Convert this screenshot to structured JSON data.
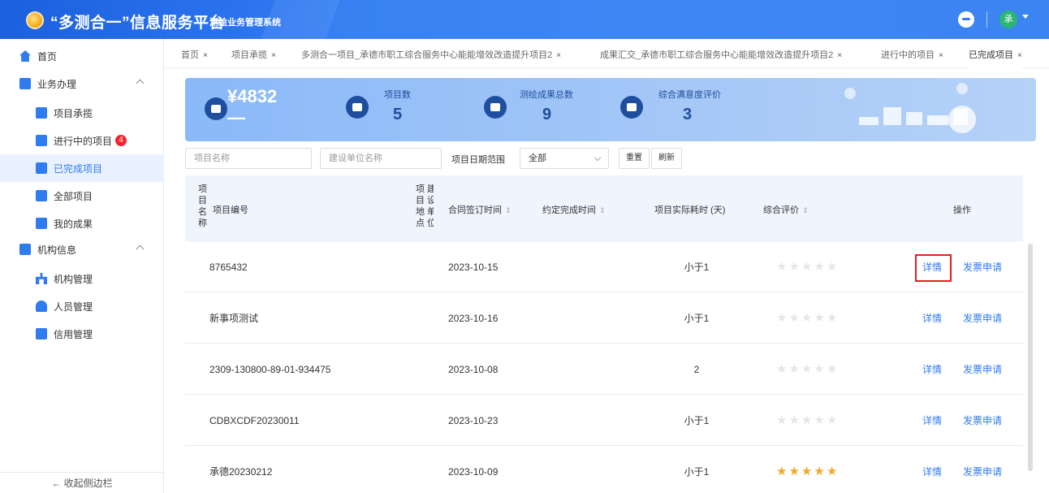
{
  "header": {
    "title": "“多测合一”信息服务平台",
    "subtitle": "测绘业务管理系统",
    "avatar_text": "承"
  },
  "sidebar": {
    "home": "首页",
    "business": "业务办理",
    "business_items": [
      "项目承揽",
      "进行中的项目",
      "已完成项目",
      "全部项目",
      "我的成果"
    ],
    "in_progress_badge": "4",
    "org": "机构信息",
    "org_items": [
      "机构管理",
      "人员管理",
      "信用管理"
    ],
    "collapse": "← 收起侧边栏"
  },
  "tabs": [
    {
      "label": "首页"
    },
    {
      "label": "项目承揽"
    },
    {
      "label": "多测合一项目_承德市职工综合服务中心能能增效改造提升项目2"
    },
    {
      "label": "成果汇交_承德市职工综合服务中心能能增效改造提升项目2"
    },
    {
      "label": "进行中的项目"
    },
    {
      "label": "已完成项目"
    }
  ],
  "stats": {
    "money": "¥4832",
    "money_dash": "—",
    "project_count_label": "项目数",
    "project_count": "5",
    "result_total_label": "测绘成果总数",
    "result_total": "9",
    "satisfaction_label": "综合满意度评价",
    "satisfaction": "3"
  },
  "filters": {
    "project_name_placeholder": "项目名称",
    "builder_placeholder": "建设单位名称",
    "date_range_label": "项目日期范围",
    "date_range_value": "全部",
    "reset": "重置",
    "refresh": "刷新"
  },
  "table": {
    "col_name_vertical": [
      "项",
      "目",
      "名",
      "称"
    ],
    "col_code": "项目编号",
    "col_location_vertical": [
      "项",
      "目",
      "地",
      "点"
    ],
    "col_location_vertical2": [
      "建",
      "设",
      "单",
      "位"
    ],
    "col_sign_date": "合同签订时间",
    "col_due": "约定完成时间",
    "col_days": "项目实际耗时 (天)",
    "col_rating": "综合评价",
    "col_ops": "操作",
    "detail_label": "详情",
    "invoice_label": "发票申请",
    "rows": [
      {
        "code": "8765432",
        "sign_date": "2023-10-15",
        "days": "小于1",
        "rating": 0
      },
      {
        "code": "新事项测试",
        "sign_date": "2023-10-16",
        "days": "小于1",
        "rating": 0
      },
      {
        "code": "2309-130800-89-01-934475",
        "sign_date": "2023-10-08",
        "days": "2",
        "rating": 0
      },
      {
        "code": "CDBXCDF20230011",
        "sign_date": "2023-10-23",
        "days": "小于1",
        "rating": 0
      },
      {
        "code": "承德20230212",
        "sign_date": "2023-10-09",
        "days": "小于1",
        "rating": 5
      }
    ]
  },
  "colors": {
    "primary": "#2f7bf0",
    "star_on": "#f5a623",
    "highlight": "#e02020"
  }
}
